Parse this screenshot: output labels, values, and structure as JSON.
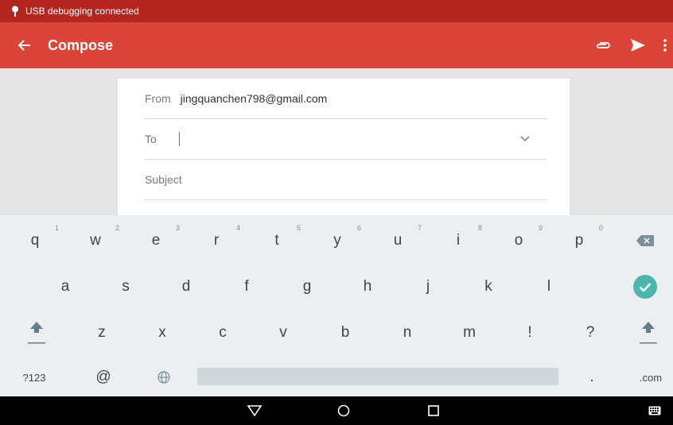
{
  "status_bar": {
    "text": "USB debugging connected"
  },
  "toolbar": {
    "title": "Compose"
  },
  "compose": {
    "from_label": "From",
    "from_value": "jingquanchen798@gmail.com",
    "to_label": "To",
    "subject_placeholder": "Subject"
  },
  "keyboard": {
    "row1": [
      {
        "k": "q",
        "h": "1"
      },
      {
        "k": "w",
        "h": "2"
      },
      {
        "k": "e",
        "h": "3"
      },
      {
        "k": "r",
        "h": "4"
      },
      {
        "k": "t",
        "h": "5"
      },
      {
        "k": "y",
        "h": "6"
      },
      {
        "k": "u",
        "h": "7"
      },
      {
        "k": "i",
        "h": "8"
      },
      {
        "k": "o",
        "h": "9"
      },
      {
        "k": "p",
        "h": "0"
      }
    ],
    "row2": [
      "a",
      "s",
      "d",
      "f",
      "g",
      "h",
      "j",
      "k",
      "l"
    ],
    "row3": [
      "z",
      "x",
      "c",
      "v",
      "b",
      "n",
      "m",
      "!",
      "?"
    ],
    "symbols_label": "?123",
    "at_label": "@",
    "period_label": ".",
    "com_label": ".com"
  },
  "colors": {
    "status_bar": "#b3261e",
    "toolbar": "#db4437",
    "keyboard_bg": "#eceff1",
    "enter_key": "#4db6ac"
  },
  "icons": {
    "back": "arrow-back-icon",
    "attach": "paperclip-icon",
    "send": "send-icon",
    "overflow": "more-vert-icon",
    "globe": "globe-icon",
    "backspace": "backspace-icon",
    "enter": "check-icon",
    "shift": "shift-icon"
  }
}
